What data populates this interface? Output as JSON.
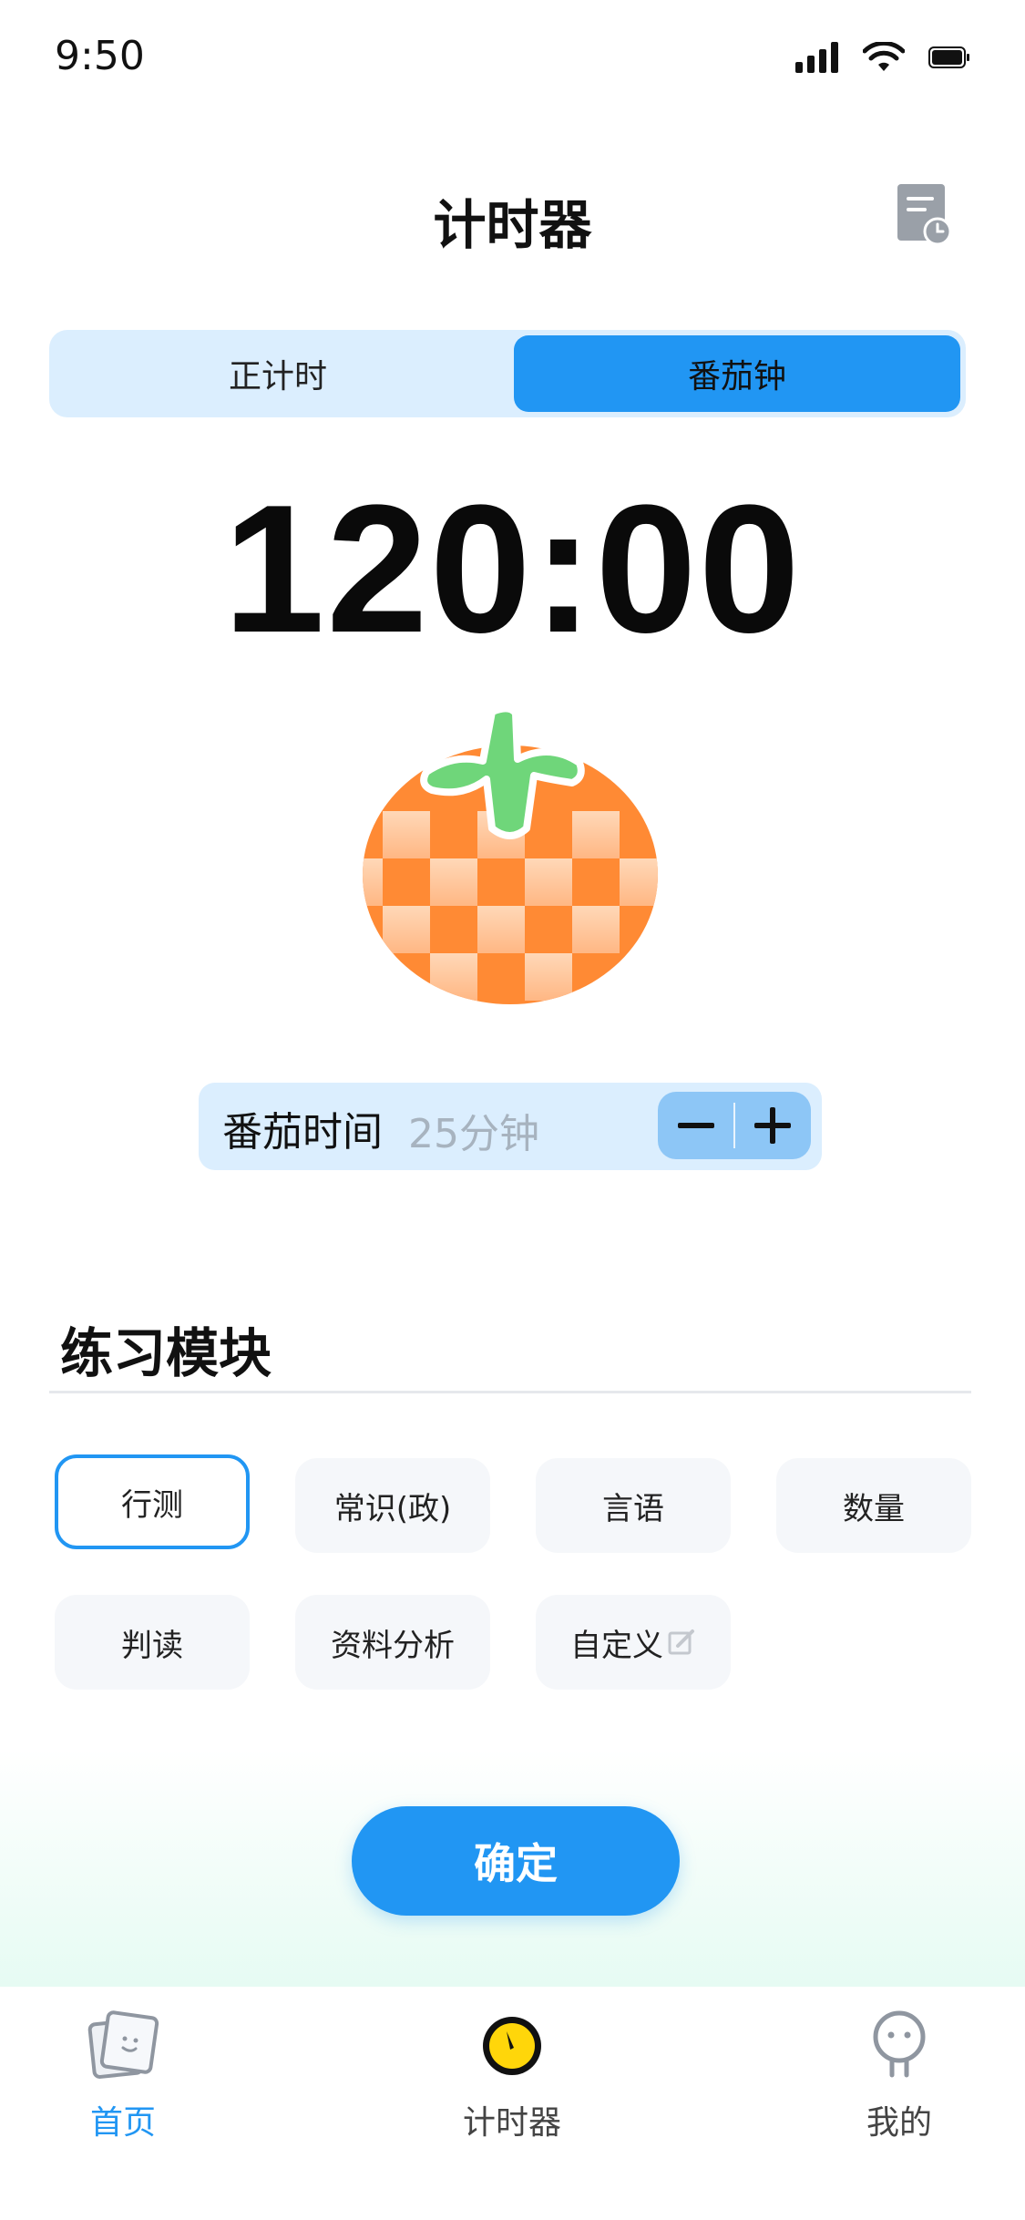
{
  "status_bar": {
    "time": "9:50"
  },
  "header": {
    "title": "计时器",
    "history_icon": "history-icon"
  },
  "segment": {
    "left": "正计时",
    "right": "番茄钟",
    "active": "right"
  },
  "timer": {
    "display": "120:00"
  },
  "pomodoro": {
    "label": "番茄时间",
    "value": "25分钟"
  },
  "practice": {
    "title": "练习模块",
    "chips": [
      "行测",
      "常识(政)",
      "言语",
      "数量",
      "判读",
      "资料分析",
      "自定义"
    ],
    "selected": "行测"
  },
  "confirm_label": "确定",
  "tabbar": {
    "items": [
      {
        "label": "首页",
        "icon": "home-cards-icon"
      },
      {
        "label": "计时器",
        "icon": "timer-icon"
      },
      {
        "label": "我的",
        "icon": "profile-icon"
      }
    ],
    "active": "首页"
  },
  "colors": {
    "accent": "#2196f3",
    "light_accent": "#dbeefe",
    "chip_bg": "#f5f7fa"
  }
}
